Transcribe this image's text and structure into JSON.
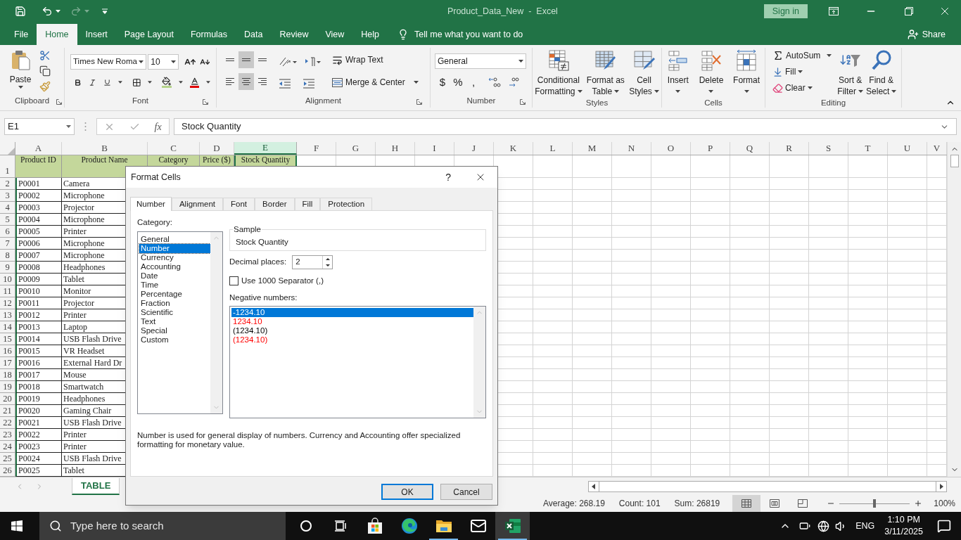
{
  "window": {
    "title": "Product_Data_New  -  Excel",
    "sign_in": "Sign in"
  },
  "menu_tabs": [
    {
      "label": "File",
      "selected": false
    },
    {
      "label": "Home",
      "selected": true
    },
    {
      "label": "Insert",
      "selected": false
    },
    {
      "label": "Page Layout",
      "selected": false
    },
    {
      "label": "Formulas",
      "selected": false
    },
    {
      "label": "Data",
      "selected": false
    },
    {
      "label": "Review",
      "selected": false
    },
    {
      "label": "View",
      "selected": false
    },
    {
      "label": "Help",
      "selected": false
    }
  ],
  "tell_me": "Tell me what you want to do",
  "share": "Share",
  "ribbon": {
    "clipboard": {
      "paste": "Paste",
      "label": "Clipboard"
    },
    "font": {
      "name": "Times New Roma",
      "size": "10",
      "label": "Font"
    },
    "alignment": {
      "buttons": [
        {
          "kind": "top",
          "selected": false
        },
        {
          "kind": "middle",
          "selected": true
        },
        {
          "kind": "bottom",
          "selected": false
        },
        {
          "kind": "left",
          "selected": false
        },
        {
          "kind": "center",
          "selected": true
        },
        {
          "kind": "right",
          "selected": false
        }
      ],
      "wrap": "Wrap Text",
      "merge": "Merge & Center",
      "label": "Alignment"
    },
    "number": {
      "format": "General",
      "symbols": [
        "$",
        "%",
        ","
      ],
      "label": "Number"
    },
    "styles": {
      "buttons": [
        {
          "kind": "conditional",
          "lines": [
            "Conditional",
            "Formatting"
          ]
        },
        {
          "kind": "table",
          "lines": [
            "Format as",
            "Table"
          ]
        },
        {
          "kind": "cell",
          "lines": [
            "Cell",
            "Styles"
          ]
        }
      ],
      "label": "Styles"
    },
    "cells": {
      "buttons": [
        {
          "kind": "insert",
          "label": "Insert"
        },
        {
          "kind": "delete",
          "label": "Delete"
        },
        {
          "kind": "format",
          "label": "Format"
        }
      ],
      "label": "Cells"
    },
    "editing": {
      "autosum": "AutoSum",
      "fill": "Fill",
      "clear": "Clear",
      "buttons": [
        {
          "kind": "sort",
          "lines": [
            "Sort &",
            "Filter"
          ]
        },
        {
          "kind": "find",
          "lines": [
            "Find &",
            "Select"
          ]
        }
      ],
      "label": "Editing"
    }
  },
  "formula_bar": {
    "name_box": "E1",
    "function_button": "fx",
    "formula": "Stock Quantity"
  },
  "sheet": {
    "columns": [
      {
        "label": "A",
        "selected": false
      },
      {
        "label": "B",
        "selected": false
      },
      {
        "label": "C",
        "selected": false
      },
      {
        "label": "D",
        "selected": false
      },
      {
        "label": "E",
        "selected": true
      },
      {
        "label": "F",
        "selected": false
      },
      {
        "label": "G",
        "selected": false
      },
      {
        "label": "H",
        "selected": false
      },
      {
        "label": "I",
        "selected": false
      },
      {
        "label": "J",
        "selected": false
      },
      {
        "label": "K",
        "selected": false
      },
      {
        "label": "L",
        "selected": false
      },
      {
        "label": "M",
        "selected": false
      },
      {
        "label": "N",
        "selected": false
      },
      {
        "label": "O",
        "selected": false
      },
      {
        "label": "P",
        "selected": false
      },
      {
        "label": "Q",
        "selected": false
      },
      {
        "label": "R",
        "selected": false
      },
      {
        "label": "S",
        "selected": false
      },
      {
        "label": "T",
        "selected": false
      },
      {
        "label": "U",
        "selected": false
      },
      {
        "label": "V",
        "selected": false
      }
    ],
    "header_row": {
      "number": "1",
      "cells": [
        {
          "text": "Product ID",
          "selected": false
        },
        {
          "text": "Product Name",
          "selected": false
        },
        {
          "text": "Category",
          "selected": false
        },
        {
          "text": "Price ($)",
          "selected": false
        },
        {
          "text": "Stock Quantity",
          "selected": true
        }
      ]
    },
    "rows": [
      {
        "number": "2",
        "cells": [
          "P0001",
          "Camera"
        ]
      },
      {
        "number": "3",
        "cells": [
          "P0002",
          "Microphone"
        ]
      },
      {
        "number": "4",
        "cells": [
          "P0003",
          "Projector"
        ]
      },
      {
        "number": "5",
        "cells": [
          "P0004",
          "Microphone"
        ]
      },
      {
        "number": "6",
        "cells": [
          "P0005",
          "Printer"
        ]
      },
      {
        "number": "7",
        "cells": [
          "P0006",
          "Microphone"
        ]
      },
      {
        "number": "8",
        "cells": [
          "P0007",
          "Microphone"
        ]
      },
      {
        "number": "9",
        "cells": [
          "P0008",
          "Headphones"
        ]
      },
      {
        "number": "10",
        "cells": [
          "P0009",
          "Tablet"
        ]
      },
      {
        "number": "11",
        "cells": [
          "P0010",
          "Monitor"
        ]
      },
      {
        "number": "12",
        "cells": [
          "P0011",
          "Projector"
        ]
      },
      {
        "number": "13",
        "cells": [
          "P0012",
          "Printer"
        ]
      },
      {
        "number": "14",
        "cells": [
          "P0013",
          "Laptop"
        ]
      },
      {
        "number": "15",
        "cells": [
          "P0014",
          "USB Flash Drive"
        ]
      },
      {
        "number": "16",
        "cells": [
          "P0015",
          "VR Headset"
        ]
      },
      {
        "number": "17",
        "cells": [
          "P0016",
          "External Hard Dr"
        ]
      },
      {
        "number": "18",
        "cells": [
          "P0017",
          "Mouse"
        ]
      },
      {
        "number": "19",
        "cells": [
          "P0018",
          "Smartwatch"
        ]
      },
      {
        "number": "20",
        "cells": [
          "P0019",
          "Headphones"
        ]
      },
      {
        "number": "21",
        "cells": [
          "P0020",
          "Gaming Chair"
        ]
      },
      {
        "number": "22",
        "cells": [
          "P0021",
          "USB Flash Drive"
        ]
      },
      {
        "number": "23",
        "cells": [
          "P0022",
          "Printer"
        ]
      },
      {
        "number": "24",
        "cells": [
          "P0023",
          "Printer"
        ]
      },
      {
        "number": "25",
        "cells": [
          "P0024",
          "USB Flash Drive"
        ]
      },
      {
        "number": "26",
        "cells": [
          "P0025",
          "Tablet"
        ]
      }
    ]
  },
  "sheet_tabs": [
    {
      "label": "TABLE",
      "selected": true
    }
  ],
  "status_bar": {
    "average": "Average: 268.19",
    "count": "Count: 101",
    "sum": "Sum: 26819",
    "views": [
      {
        "kind": "normal",
        "selected": true
      },
      {
        "kind": "page_layout",
        "selected": false
      },
      {
        "kind": "page_break",
        "selected": false
      }
    ],
    "zoom": {
      "level": 0.5,
      "reading": "100%"
    }
  },
  "dialog": {
    "title": "Format Cells",
    "help": "?",
    "tabs": [
      {
        "label": "Number",
        "selected": true
      },
      {
        "label": "Alignment",
        "selected": false
      },
      {
        "label": "Font",
        "selected": false
      },
      {
        "label": "Border",
        "selected": false
      },
      {
        "label": "Fill",
        "selected": false
      },
      {
        "label": "Protection",
        "selected": false
      }
    ],
    "category_label": "Category:",
    "categories": [
      {
        "label": "General",
        "selected": false
      },
      {
        "label": "Number",
        "selected": true
      },
      {
        "label": "Currency",
        "selected": false
      },
      {
        "label": "Accounting",
        "selected": false
      },
      {
        "label": "Date",
        "selected": false
      },
      {
        "label": "Time",
        "selected": false
      },
      {
        "label": "Percentage",
        "selected": false
      },
      {
        "label": "Fraction",
        "selected": false
      },
      {
        "label": "Scientific",
        "selected": false
      },
      {
        "label": "Text",
        "selected": false
      },
      {
        "label": "Special",
        "selected": false
      },
      {
        "label": "Custom",
        "selected": false
      }
    ],
    "sample_label": "Sample",
    "sample": "Stock Quantity",
    "decimal_label": "Decimal places:",
    "decimal_value": "2",
    "separator": {
      "label": "Use 1000 Separator (,)",
      "checked": false
    },
    "negative_label": "Negative numbers:",
    "negative_numbers": [
      {
        "text": "-1234.10",
        "red": false,
        "selected": true
      },
      {
        "text": "1234.10",
        "red": true,
        "selected": false
      },
      {
        "text": "(1234.10)",
        "red": false,
        "selected": false
      },
      {
        "text": "(1234.10)",
        "red": true,
        "selected": false
      }
    ],
    "description": "Number is used for general display of numbers.  Currency and Accounting offer specialized formatting for monetary value.",
    "buttons": [
      {
        "label": "OK",
        "kind": "default"
      },
      {
        "label": "Cancel",
        "kind": "normal"
      }
    ]
  },
  "taskbar": {
    "search_placeholder": "Type here to search",
    "apps": [
      {
        "kind": "cortana",
        "running": false
      },
      {
        "kind": "task_view",
        "running": false
      },
      {
        "kind": "store",
        "running": false
      },
      {
        "kind": "edge",
        "running": false
      },
      {
        "kind": "explorer",
        "running": true
      },
      {
        "kind": "mail",
        "running": false
      },
      {
        "kind": "excel",
        "running": true
      }
    ],
    "language": "ENG",
    "time": "1:10 PM",
    "date": "3/11/2025"
  }
}
